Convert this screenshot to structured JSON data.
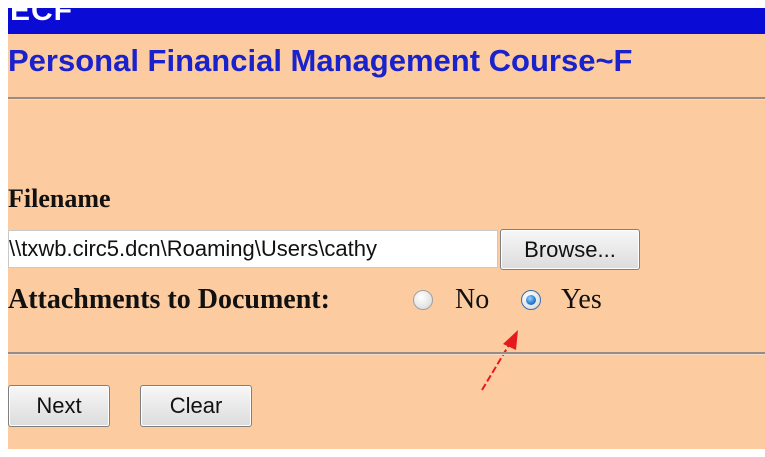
{
  "banner": {
    "logo_text": "ECF"
  },
  "header": {
    "title": "Personal Financial Management Course~F"
  },
  "form": {
    "filename_label": "Filename",
    "filename_value": "\\\\txwb.circ5.dcn\\Roaming\\Users\\cathy",
    "browse_label": "Browse...",
    "attachments_label": "Attachments to Document:",
    "attachments_options": [
      {
        "label": "No",
        "selected": false
      },
      {
        "label": "Yes",
        "selected": true
      }
    ]
  },
  "actions": {
    "next_label": "Next",
    "clear_label": "Clear"
  },
  "annotation": {
    "arrow_icon": "red-arrow-icon",
    "arrow_color": "#e8191e"
  },
  "colors": {
    "page_background": "#fccca0",
    "banner": "#0b0bd6",
    "title": "#1a22cc"
  }
}
